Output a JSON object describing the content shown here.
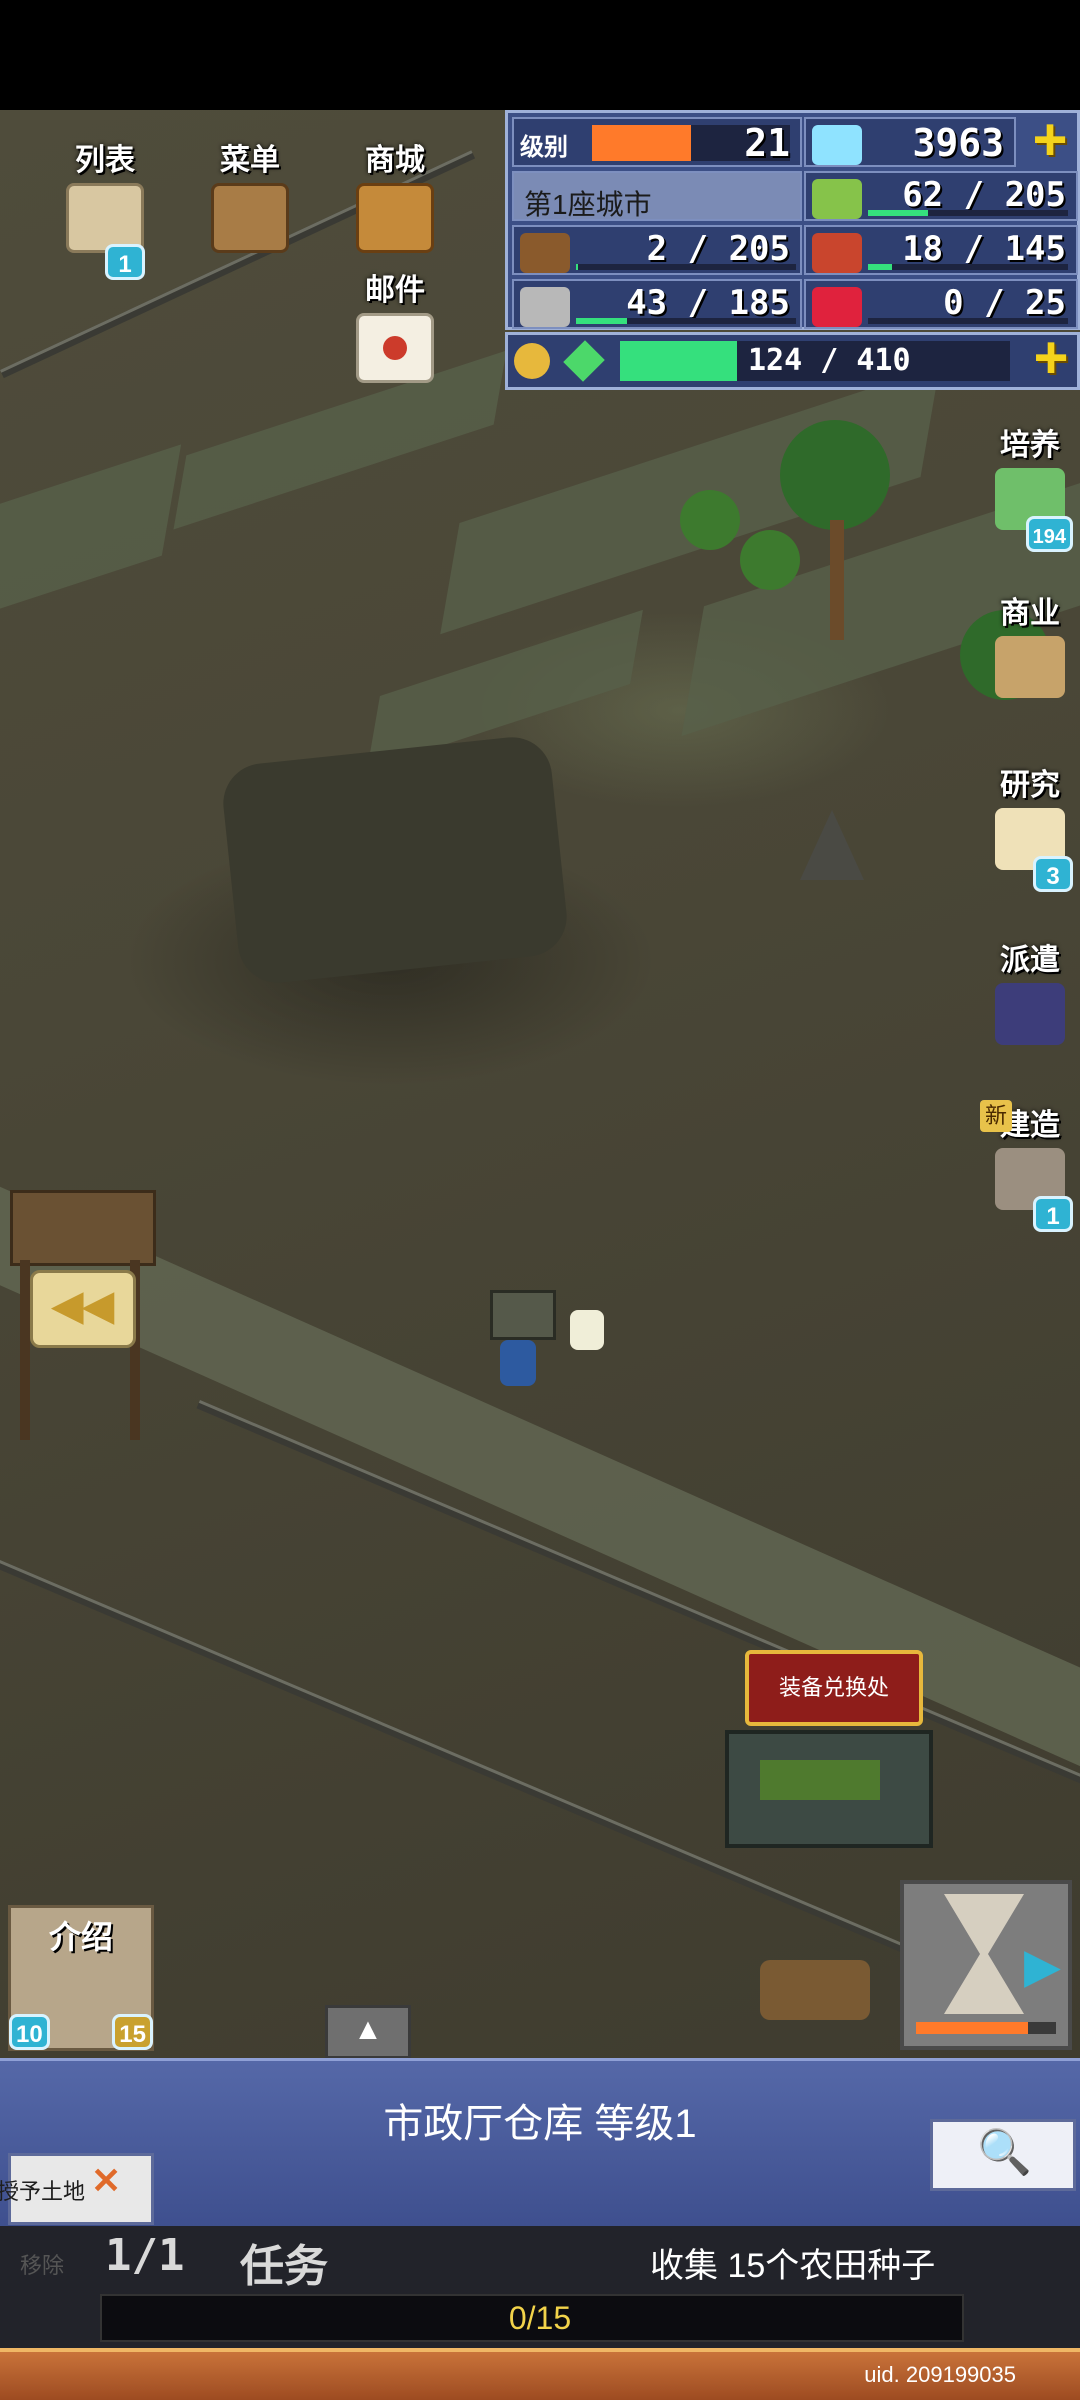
{
  "top_menu": {
    "list_label": "列表",
    "list_badge": "1",
    "menu_label": "菜单",
    "shop_label": "商城",
    "mail_label": "邮件"
  },
  "status": {
    "level_label": "级别",
    "level_value": "21",
    "level_progress": 0.5,
    "gems": "3963",
    "city_name": "第1座城市",
    "crops": {
      "current": "62",
      "max": "205",
      "progress": 0.3
    },
    "wood": {
      "current": "2",
      "max": "205",
      "progress": 0.01
    },
    "food": {
      "current": "18",
      "max": "145",
      "progress": 0.12
    },
    "stone": {
      "current": "43",
      "max": "185",
      "progress": 0.23
    },
    "ruby": {
      "current": "0",
      "max": "25",
      "progress": 0.0
    },
    "energy": {
      "value": "124 / 410",
      "progress": 0.3
    }
  },
  "side_menu": {
    "train_label": "培养",
    "train_badge": "194",
    "commerce_label": "商业",
    "research_label": "研究",
    "research_badge": "3",
    "dispatch_label": "派遣",
    "build_new_tag": "新",
    "build_label": "建造",
    "build_badge": "1"
  },
  "map": {
    "building_tag": "装备兑换处"
  },
  "bottom_left": {
    "intro_label": "介绍",
    "badge_left": "10",
    "badge_right": "15"
  },
  "info_panel": {
    "title": "市政厅仓库 等级1",
    "give_land_label": "授予土地",
    "remove_label": "移除"
  },
  "quest": {
    "count": "1/1",
    "label": "任务",
    "description": "收集 15个农田种子",
    "progress_text": "0/15",
    "progress": 0.0
  },
  "footer": {
    "uid": "uid. 209199035"
  },
  "colors": {
    "accent_plus": "#f4d31c",
    "panel_blue": "#3c4f86",
    "badge_cyan": "#2fb3d3",
    "level_orange": "#ff7a2a",
    "progress_green": "#35e07d"
  }
}
